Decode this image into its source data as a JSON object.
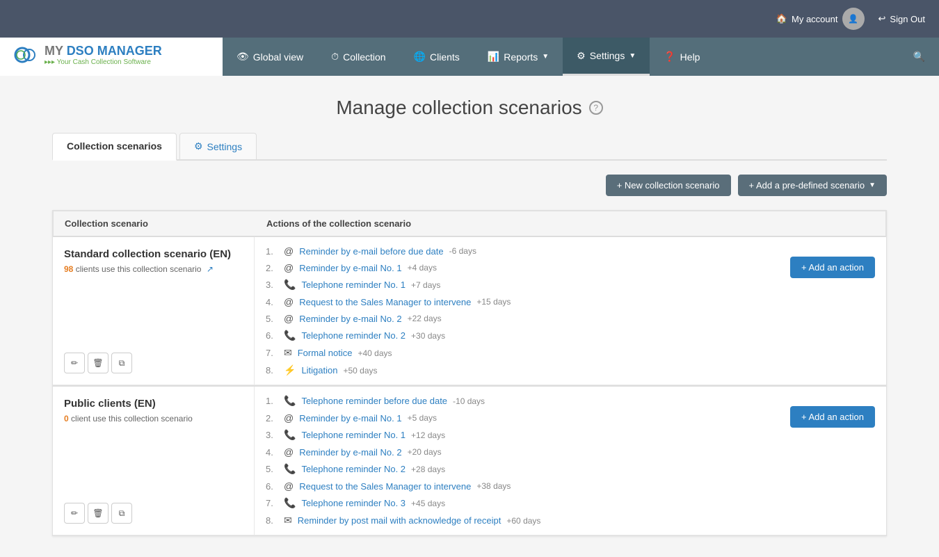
{
  "topbar": {
    "my_account_label": "My account",
    "sign_out_label": "Sign Out"
  },
  "navbar": {
    "items": [
      {
        "id": "global-view",
        "label": "Global view",
        "icon": "👁"
      },
      {
        "id": "collection",
        "label": "Collection",
        "icon": "⏱"
      },
      {
        "id": "clients",
        "label": "Clients",
        "icon": "🌐"
      },
      {
        "id": "reports",
        "label": "Reports",
        "icon": "📊",
        "has_dropdown": true
      },
      {
        "id": "settings",
        "label": "Settings",
        "icon": "⚙",
        "active": true,
        "has_dropdown": true
      },
      {
        "id": "help",
        "label": "Help",
        "icon": "❓"
      }
    ]
  },
  "page": {
    "title": "Manage collection scenarios",
    "tabs": [
      {
        "id": "collection-scenarios",
        "label": "Collection scenarios",
        "active": true
      },
      {
        "id": "settings",
        "label": "Settings",
        "active": false
      }
    ],
    "buttons": {
      "new_scenario": "+ New collection scenario",
      "add_predefined": "+ Add a pre-defined scenario"
    },
    "table": {
      "col1": "Collection scenario",
      "col2": "Actions of the collection scenario"
    }
  },
  "scenarios": [
    {
      "id": "standard-en",
      "name": "Standard collection scenario (EN)",
      "clients_count": "98",
      "clients_label": "clients use this collection scenario",
      "actions": [
        {
          "num": "1.",
          "icon": "email",
          "label": "Reminder by e-mail before due date",
          "days": "-6 days"
        },
        {
          "num": "2.",
          "icon": "email",
          "label": "Reminder by e-mail No. 1",
          "days": "+4 days"
        },
        {
          "num": "3.",
          "icon": "phone",
          "label": "Telephone reminder No. 1",
          "days": "+7 days"
        },
        {
          "num": "4.",
          "icon": "email",
          "label": "Request to the Sales Manager to intervene",
          "days": "+15 days"
        },
        {
          "num": "5.",
          "icon": "email",
          "label": "Reminder by e-mail No. 2",
          "days": "+22 days"
        },
        {
          "num": "6.",
          "icon": "phone",
          "label": "Telephone reminder No. 2",
          "days": "+30 days"
        },
        {
          "num": "7.",
          "icon": "letter",
          "label": "Formal notice",
          "days": "+40 days"
        },
        {
          "num": "8.",
          "icon": "lightning",
          "label": "Litigation",
          "days": "+50 days"
        }
      ],
      "add_action_label": "+ Add an action"
    },
    {
      "id": "public-en",
      "name": "Public clients (EN)",
      "clients_count": "0",
      "clients_label": "client use this collection scenario",
      "actions": [
        {
          "num": "1.",
          "icon": "phone",
          "label": "Telephone reminder before due date",
          "days": "-10 days"
        },
        {
          "num": "2.",
          "icon": "email",
          "label": "Reminder by e-mail No. 1",
          "days": "+5 days"
        },
        {
          "num": "3.",
          "icon": "phone",
          "label": "Telephone reminder No. 1",
          "days": "+12 days"
        },
        {
          "num": "4.",
          "icon": "email",
          "label": "Reminder by e-mail No. 2",
          "days": "+20 days"
        },
        {
          "num": "5.",
          "icon": "phone",
          "label": "Telephone reminder No. 2",
          "days": "+28 days"
        },
        {
          "num": "6.",
          "icon": "email",
          "label": "Request to the Sales Manager to intervene",
          "days": "+38 days"
        },
        {
          "num": "7.",
          "icon": "phone",
          "label": "Telephone reminder No. 3",
          "days": "+45 days"
        },
        {
          "num": "8.",
          "icon": "letter",
          "label": "Reminder by post mail with acknowledge of receipt",
          "days": "+60 days"
        }
      ],
      "add_action_label": "+ Add an action"
    }
  ],
  "icons": {
    "email": "@",
    "phone": "📞",
    "letter": "✉",
    "lightning": "⚡",
    "edit": "✏",
    "delete": "🗑",
    "copy": "⧉",
    "gear": "⚙",
    "home": "🏠",
    "signout": "↩",
    "search": "🔍"
  },
  "colors": {
    "primary": "#2d7fc1",
    "navbar_bg": "#546e7a",
    "topbar_bg": "#4a5568",
    "accent_orange": "#e67e22"
  }
}
